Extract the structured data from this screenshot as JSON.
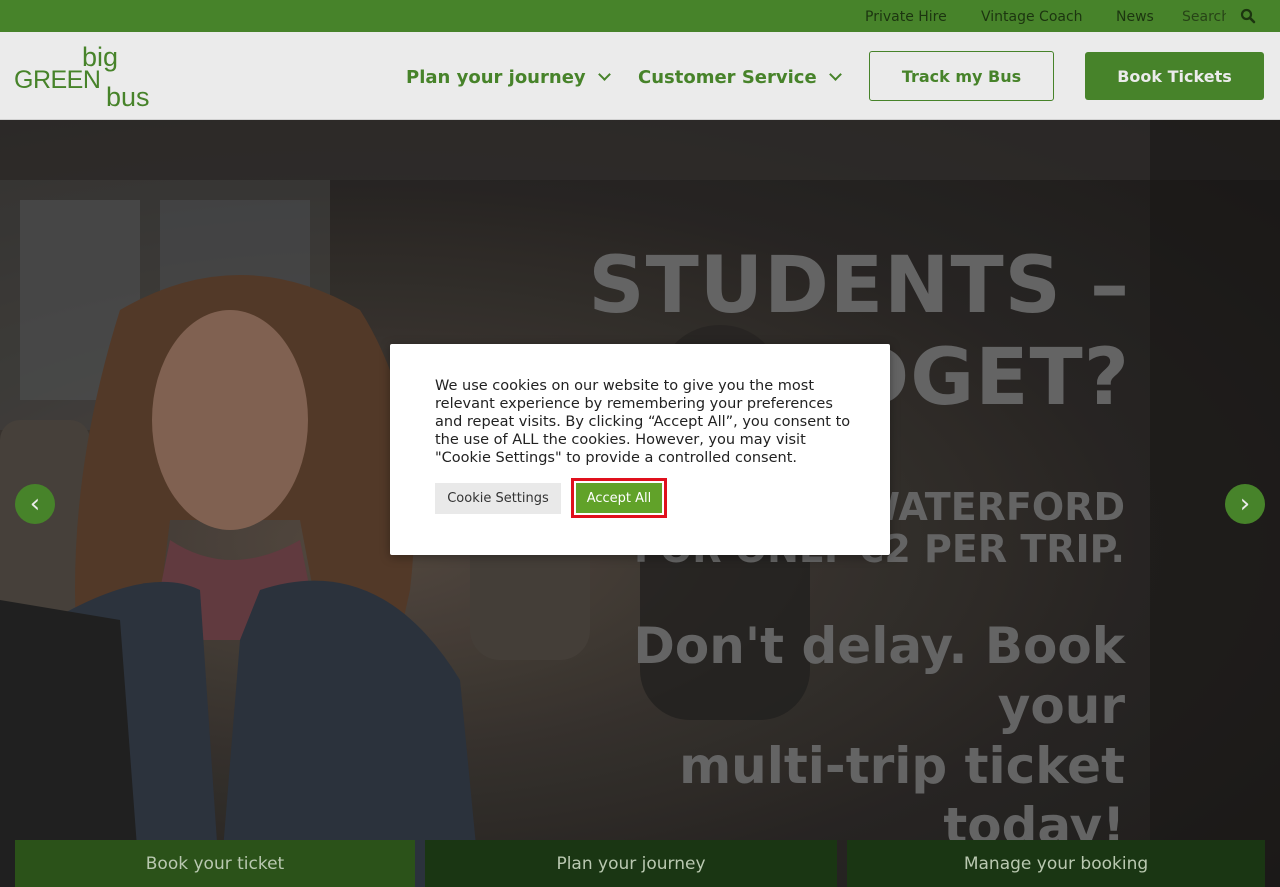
{
  "topbar": {
    "links": [
      "Private Hire",
      "Vintage Coach",
      "News"
    ],
    "search_placeholder": "Search"
  },
  "header": {
    "logo": {
      "line1": "big",
      "line2": "GREEN",
      "line3": "bus"
    },
    "nav": [
      "Plan your journey",
      "Customer Service"
    ],
    "track_button": "Track my Bus",
    "book_button": "Book Tickets"
  },
  "hero": {
    "headline_line1": "STUDENTS –",
    "headline_line2": "BUDGET?",
    "mid_line1": "WATERFORD",
    "mid_line2": "FOR ONLY €2 PER TRIP.",
    "cta_line1": "Don't delay. Book your",
    "cta_line2": "multi-trip ticket today!",
    "prev_arrow": "‹",
    "next_arrow": "›"
  },
  "tabs": [
    "Book your ticket",
    "Plan your journey",
    "Manage your booking"
  ],
  "cookie": {
    "text": "We use cookies on our website to give you the most relevant experience by remembering your preferences and repeat visits. By clicking “Accept All”, you consent to the use of ALL the cookies. However, you may visit \"Cookie Settings\" to provide a controlled consent.",
    "settings_button": "Cookie Settings",
    "accept_button": "Accept All"
  },
  "colors": {
    "brand_green": "#4e8f2e",
    "accept_green": "#61a229",
    "highlight_red": "#e0101d"
  }
}
